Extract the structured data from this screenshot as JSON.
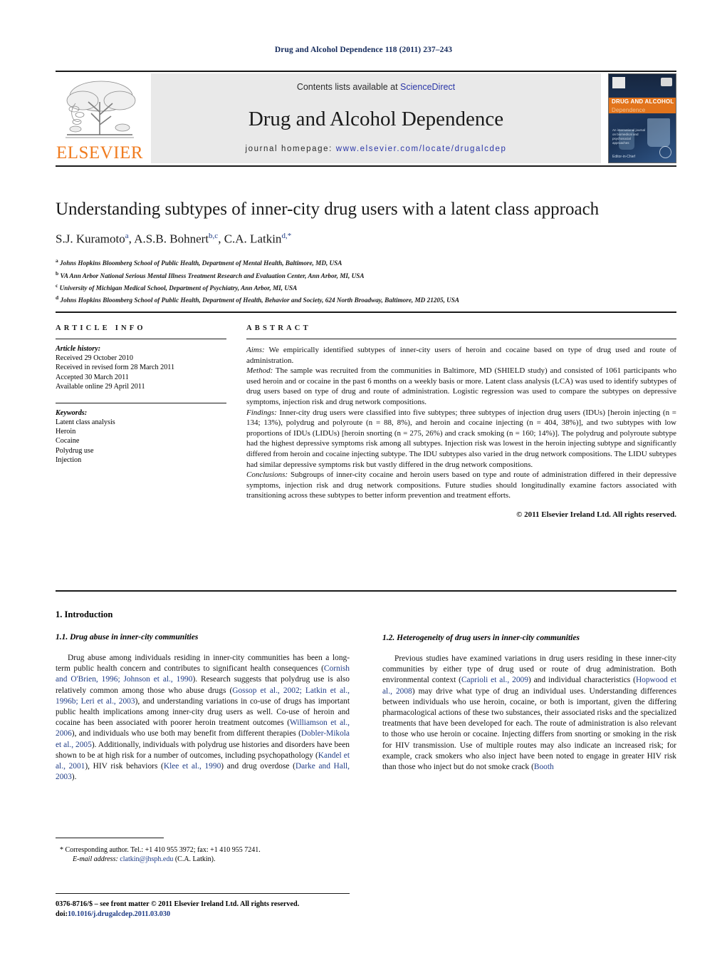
{
  "header": {
    "running_head": "Drug and Alcohol Dependence 118 (2011) 237–243",
    "contents_prefix": "Contents lists available at ",
    "contents_link": "ScienceDirect",
    "journal_title": "Drug and Alcohol Dependence",
    "homepage_prefix": "journal homepage: ",
    "homepage_url": "www.elsevier.com/locate/drugalcdep",
    "publisher_wordmark": "ELSEVIER",
    "cover": {
      "title": "DRUG AND ALCOHOL",
      "subtitle": "Dependence",
      "blurb": "An international journal on biomedical and psychosocial approaches",
      "caption": "Editor-in-Chief"
    }
  },
  "title_block": {
    "title": "Understanding subtypes of inner-city drug users with a latent class approach",
    "authors": [
      {
        "name": "S.J. Kuramoto",
        "sup": "a"
      },
      {
        "name": "A.S.B. Bohnert",
        "sup": "b,c"
      },
      {
        "name": "C.A. Latkin",
        "sup": "d,*"
      }
    ],
    "affiliations": [
      {
        "marker": "a",
        "text": "Johns Hopkins Bloomberg School of Public Health, Department of Mental Health, Baltimore, MD, USA"
      },
      {
        "marker": "b",
        "text": "VA Ann Arbor National Serious Mental Illness Treatment Research and Evaluation Center, Ann Arbor, MI, USA"
      },
      {
        "marker": "c",
        "text": "University of Michigan Medical School, Department of Psychiatry, Ann Arbor, MI, USA"
      },
      {
        "marker": "d",
        "text": "Johns Hopkins Bloomberg School of Public Health, Department of Health, Behavior and Society, 624 North Broadway, Baltimore, MD 21205, USA"
      }
    ]
  },
  "article_info": {
    "heading": "ARTICLE INFO",
    "history_label": "Article history:",
    "history": [
      "Received 29 October 2010",
      "Received in revised form 28 March 2011",
      "Accepted 30 March 2011",
      "Available online 29 April 2011"
    ],
    "keywords_label": "Keywords:",
    "keywords": [
      "Latent class analysis",
      "Heroin",
      "Cocaine",
      "Polydrug use",
      "Injection"
    ]
  },
  "abstract": {
    "heading": "ABSTRACT",
    "aims_label": "Aims:",
    "aims_text": " We empirically identified subtypes of inner-city users of heroin and cocaine based on type of drug used and route of administration.",
    "method_label": "Method:",
    "method_text": " The sample was recruited from the communities in Baltimore, MD (SHIELD study) and consisted of 1061 participants who used heroin and or cocaine in the past 6 months on a weekly basis or more. Latent class analysis (LCA) was used to identify subtypes of drug users based on type of drug and route of administration. Logistic regression was used to compare the subtypes on depressive symptoms, injection risk and drug network compositions.",
    "findings_label": "Findings:",
    "findings_text": " Inner-city drug users were classified into five subtypes; three subtypes of injection drug users (IDUs) [heroin injecting (n = 134; 13%), polydrug and polyroute (n = 88, 8%), and heroin and cocaine injecting (n = 404, 38%)], and two subtypes with low proportions of IDUs (LIDUs) [heroin snorting (n = 275, 26%) and crack smoking (n = 160; 14%)]. The polydrug and polyroute subtype had the highest depressive symptoms risk among all subtypes. Injection risk was lowest in the heroin injecting subtype and significantly differed from heroin and cocaine injecting subtype. The IDU subtypes also varied in the drug network compositions. The LIDU subtypes had similar depressive symptoms risk but vastly differed in the drug network compositions.",
    "conclusions_label": "Conclusions:",
    "conclusions_text": " Subgroups of inner-city cocaine and heroin users based on type and route of administration differed in their depressive symptoms, injection risk and drug network compositions. Future studies should longitudinally examine factors associated with transitioning across these subtypes to better inform prevention and treatment efforts.",
    "copyright": "© 2011 Elsevier Ireland Ltd. All rights reserved."
  },
  "body": {
    "section1_heading": "1. Introduction",
    "section11_heading": "1.1. Drug abuse in inner-city communities",
    "para11_a": "Drug abuse among individuals residing in inner-city communities has been a long-term public health concern and contributes to significant health consequences (",
    "para11_ref1": "Cornish and O'Brien, 1996; Johnson et al., 1990",
    "para11_b": "). Research suggests that polydrug use is also relatively common among those who abuse drugs (",
    "para11_ref2": "Gossop et al., 2002; Latkin et al., 1996b; Leri et al., 2003",
    "para11_c": "), and understanding variations in co-use of drugs has important public health implications among inner-city drug users as well. Co-use of heroin and cocaine has been associated with poorer heroin treatment outcomes (",
    "para11_ref3": "Williamson et al., 2006",
    "para11_d": "), and individuals who use both may benefit from different therapies (",
    "para11_ref4": "Dobler-Mikola et al., 2005",
    "para11_e": "). Additionally, individuals with polydrug use histories and disorders have been shown to be at high risk for a number of outcomes, including psychopathology (",
    "para11_ref5": "Kandel et al., 2001",
    "para11_f": "), HIV risk behaviors (",
    "para11_ref6": "Klee et al., 1990",
    "para11_g": ") and drug overdose (",
    "para11_ref7": "Darke and Hall, 2003",
    "para11_h": ").",
    "section12_heading": "1.2. Heterogeneity of drug users in inner-city communities",
    "para12_a": "Previous studies have examined variations in drug users residing in these inner-city communities by either type of drug used or route of drug administration. Both environmental context (",
    "para12_ref1": "Caprioli et al., 2009",
    "para12_b": ") and individual characteristics (",
    "para12_ref2": "Hopwood et al., 2008",
    "para12_c": ") may drive what type of drug an individual uses. Understanding differences between individuals who use heroin, cocaine, or both is important, given the differing pharmacological actions of these two substances, their associated risks and the specialized treatments that have been developed for each. The route of administration is also relevant to those who use heroin or cocaine. Injecting differs from snorting or smoking in the risk for HIV transmission. Use of multiple routes may also indicate an increased risk; for example, crack smokers who also inject have been noted to engage in greater HIV risk than those who inject but do not smoke crack (",
    "para12_ref3": "Booth"
  },
  "footer": {
    "corresponding_star": "*",
    "corresponding_text": " Corresponding author. Tel.: +1 410 955 3972; fax: +1 410 955 7241.",
    "email_label": "E-mail address:",
    "email": "clatkin@jhsph.edu",
    "email_owner": " (C.A. Latkin).",
    "issn_line": "0376-8716/$ – see front matter © 2011 Elsevier Ireland Ltd. All rights reserved.",
    "doi_label": "doi:",
    "doi_value": "10.1016/j.drugalcdep.2011.03.030"
  }
}
